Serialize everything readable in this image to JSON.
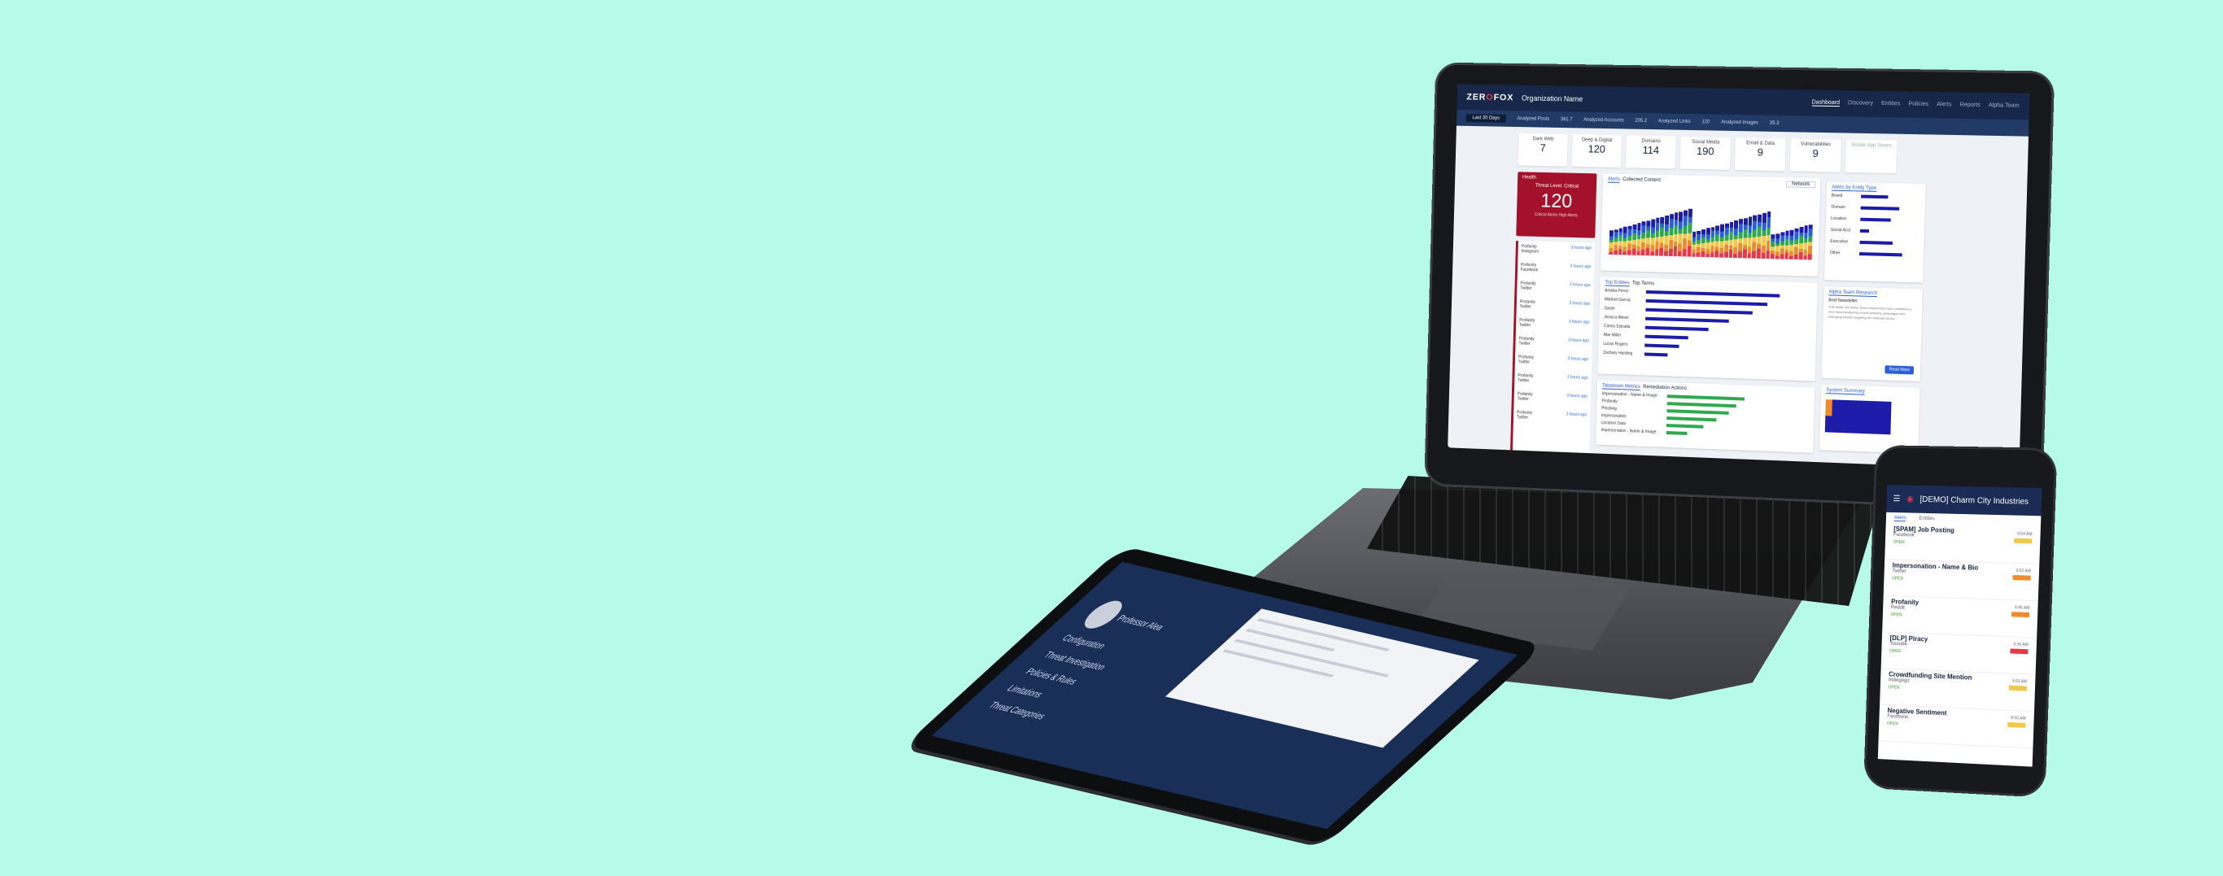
{
  "laptop": {
    "logo_prefix": "ZER",
    "logo_mark": "O",
    "logo_suffix": "FOX",
    "org_name": "Organization Name",
    "nav": [
      "Dashboard",
      "Discovery",
      "Entities",
      "Policies",
      "Alerts",
      "Reports",
      "Alpha Team"
    ],
    "filters": {
      "range": "Last 30 Days",
      "analyzed_posts": "Analyzed Posts",
      "analyzed_posts_value": "381.7",
      "analyzed_accounts": "Analyzed Accounts",
      "analyzed_accounts_value": "205.2",
      "analyzed_links": "Analyzed Links",
      "analyzed_links_value": "120",
      "analyzed_images": "Analyzed Images",
      "analyzed_images_value": "35.3"
    },
    "stats": [
      {
        "label": "Dark Web",
        "value": "7"
      },
      {
        "label": "Deep & Digital",
        "value": "120"
      },
      {
        "label": "Domains",
        "value": "114"
      },
      {
        "label": "Social Media",
        "value": "190"
      },
      {
        "label": "Email & Data",
        "value": "9"
      },
      {
        "label": "Vulnerabilities",
        "value": "9"
      },
      {
        "label": "Mobile App Stores",
        "value": ""
      }
    ],
    "threat": {
      "heading": "Health",
      "level_text": "Threat Level: Critical",
      "count": "120",
      "sub": "Critical Alerts High Alerts"
    },
    "feed": [
      {
        "title": "Profanity",
        "sub": "Instagram",
        "time": "3 hours ago"
      },
      {
        "title": "Profanity",
        "sub": "Facebook",
        "time": "3 hours ago"
      },
      {
        "title": "Profanity",
        "sub": "Twitter",
        "time": "3 hours ago"
      },
      {
        "title": "Profanity",
        "sub": "Twitter",
        "time": "3 hours ago"
      },
      {
        "title": "Profanity",
        "sub": "Twitter",
        "time": "3 hours ago"
      },
      {
        "title": "Profanity",
        "sub": "Twitter",
        "time": "3 hours ago"
      },
      {
        "title": "Profanity",
        "sub": "Twitter",
        "time": "3 hours ago"
      },
      {
        "title": "Profanity",
        "sub": "Twitter",
        "time": "3 hours ago"
      },
      {
        "title": "Profanity",
        "sub": "Twitter",
        "time": "3 hours ago"
      },
      {
        "title": "Profanity",
        "sub": "Twitter",
        "time": "3 hours ago"
      }
    ],
    "alerts_panel": {
      "tab1": "Alerts",
      "tab2": "Collected Content",
      "filter": "Network"
    },
    "alerts_by_type": {
      "title": "Alerts by Entity Type",
      "rows": [
        {
          "label": "Brand",
          "value": 0.55
        },
        {
          "label": "Domain",
          "value": 0.78
        },
        {
          "label": "Location",
          "value": 0.62
        },
        {
          "label": "Social Acct",
          "value": 0.18
        },
        {
          "label": "Executive",
          "value": 0.66
        },
        {
          "label": "Other",
          "value": 0.86
        }
      ]
    },
    "top_entities": {
      "tab1": "Top Entities",
      "tab2": "Top Terms",
      "rows": [
        {
          "label": "Amelia Perez",
          "value": 0.92
        },
        {
          "label": "Mildred Garcia",
          "value": 0.84
        },
        {
          "label": "Sarah",
          "value": 0.74
        },
        {
          "label": "Jessica Bitner",
          "value": 0.58
        },
        {
          "label": "Carlos Estrada",
          "value": 0.44
        },
        {
          "label": "Abe Miller",
          "value": 0.3
        },
        {
          "label": "Lucas Rogers",
          "value": 0.24
        },
        {
          "label": "Zachary Harding",
          "value": 0.16
        }
      ]
    },
    "research": {
      "title": "Alpha Team Research",
      "subtitle": "Brief Newsletter",
      "body": "This week, the Alpha Team researchers have published a new report analyzing recent phishing campaigns and emerging threats targeting the financial sector.",
      "button": "Read More"
    },
    "takedown": {
      "tab1": "Takedown Metrics",
      "tab2": "Remediation Actions",
      "rows": [
        {
          "label": "Impersonation - Name & Image",
          "value": 0.8
        },
        {
          "label": "Profanity",
          "value": 0.72
        },
        {
          "label": "Phishing",
          "value": 0.64
        },
        {
          "label": "Impersonation",
          "value": 0.52
        },
        {
          "label": "Location Data",
          "value": 0.38
        },
        {
          "label": "Impersonation - Name & Image",
          "value": 0.22
        }
      ]
    },
    "system_summary": {
      "title": "System Summary"
    }
  },
  "tablet": {
    "name": "Professor Alea",
    "items": [
      "Configuration",
      "Threat Investigation",
      "Policies & Rules",
      "Limitations",
      "Threat Categories"
    ]
  },
  "phone": {
    "title": "[DEMO] Charm City Industries",
    "tabs": [
      "Alerts",
      "Entities"
    ],
    "items": [
      {
        "title": "[SPAM] Job Posting",
        "source": "Facebook",
        "status": "OPEN",
        "time": "9:54 AM",
        "badge": "#f0c84a"
      },
      {
        "title": "Impersonation - Name & Bio",
        "source": "Twitter",
        "status": "OPEN",
        "time": "9:52 AM",
        "badge": "#f08a2e"
      },
      {
        "title": "Profanity",
        "source": "Reddit",
        "status": "OPEN",
        "time": "9:45 AM",
        "badge": "#f08a2e"
      },
      {
        "title": "[DLP] Piracy",
        "source": "Youtube",
        "status": "OPEN",
        "time": "9:36 AM",
        "badge": "#e8364a"
      },
      {
        "title": "Crowdfunding Site Mention",
        "source": "Indiegogo",
        "status": "OPEN",
        "time": "9:03 AM",
        "badge": "#f0c84a"
      },
      {
        "title": "Negative Sentiment",
        "source": "Facebook",
        "status": "OPEN",
        "time": "8:50 AM",
        "badge": "#f0c84a"
      }
    ]
  },
  "colors": {
    "background": "#b6fbe9",
    "navy": "#16274a",
    "threat_red": "#a3122a",
    "accent_blue": "#2b5fd6"
  }
}
